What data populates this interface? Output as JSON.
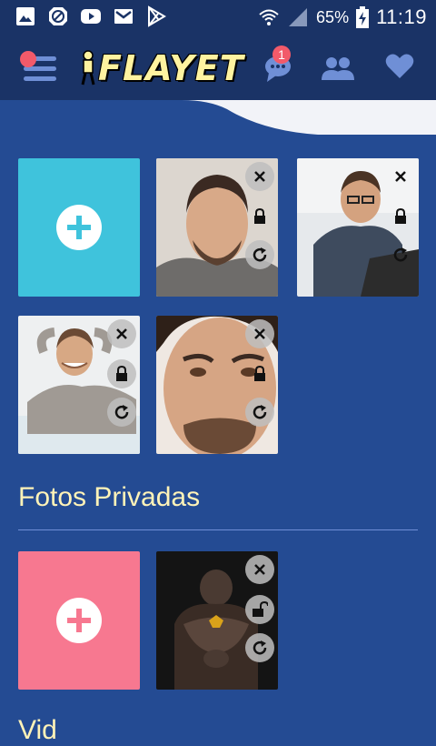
{
  "status_bar": {
    "battery_percent": "65%",
    "time": "11:19"
  },
  "app_bar": {
    "logo_text": "FLAYET",
    "chat_badge_count": "1"
  },
  "public_photos": {
    "add_tile_color": "#3fc3dc",
    "photos": [
      {
        "name": "photo-1"
      },
      {
        "name": "photo-2"
      },
      {
        "name": "photo-3"
      },
      {
        "name": "photo-4"
      }
    ]
  },
  "private_photos": {
    "title": "Fotos Privadas",
    "add_tile_color": "#f77890",
    "photos": [
      {
        "name": "private-photo-1"
      }
    ]
  },
  "next_section": {
    "title_partial": "Vid"
  },
  "colors": {
    "primary_dark": "#1a3366",
    "background": "#244b93",
    "accent_yellow": "#fff3b8",
    "badge_red": "#f25a6a",
    "icon_blue": "#6f8fd6"
  }
}
